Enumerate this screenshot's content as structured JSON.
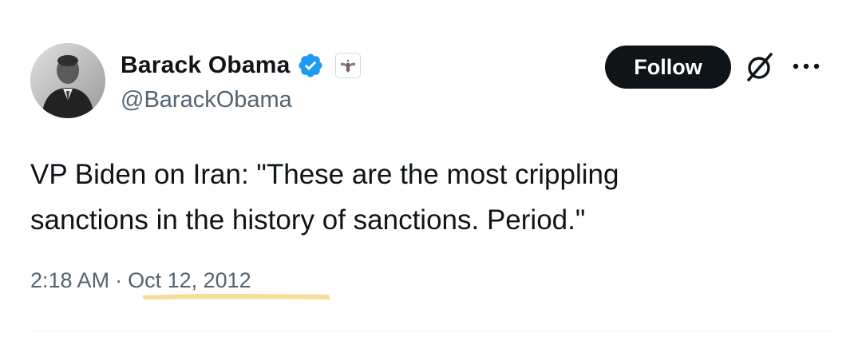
{
  "author": {
    "display_name": "Barack Obama",
    "handle": "@BarackObama",
    "avatar_icon": "user-avatar-photo",
    "verified_icon": "verified-badge-icon",
    "affiliation_icon": "government-seal-icon"
  },
  "actions": {
    "follow_label": "Follow",
    "grok_icon": "grok-icon",
    "more_icon": "more-options-icon"
  },
  "tweet": {
    "text": "VP Biden on Iran: \"These are the most crippling\nsanctions in the history of sanctions. Period.\""
  },
  "meta": {
    "time": "2:18 AM",
    "separator": "·",
    "date": "Oct 12, 2012"
  },
  "colors": {
    "verified_blue": "#1d9bf0",
    "text_primary": "#0f1419",
    "text_secondary": "#536471",
    "follow_bg": "#0f1419",
    "highlight": "#f5d78a"
  }
}
